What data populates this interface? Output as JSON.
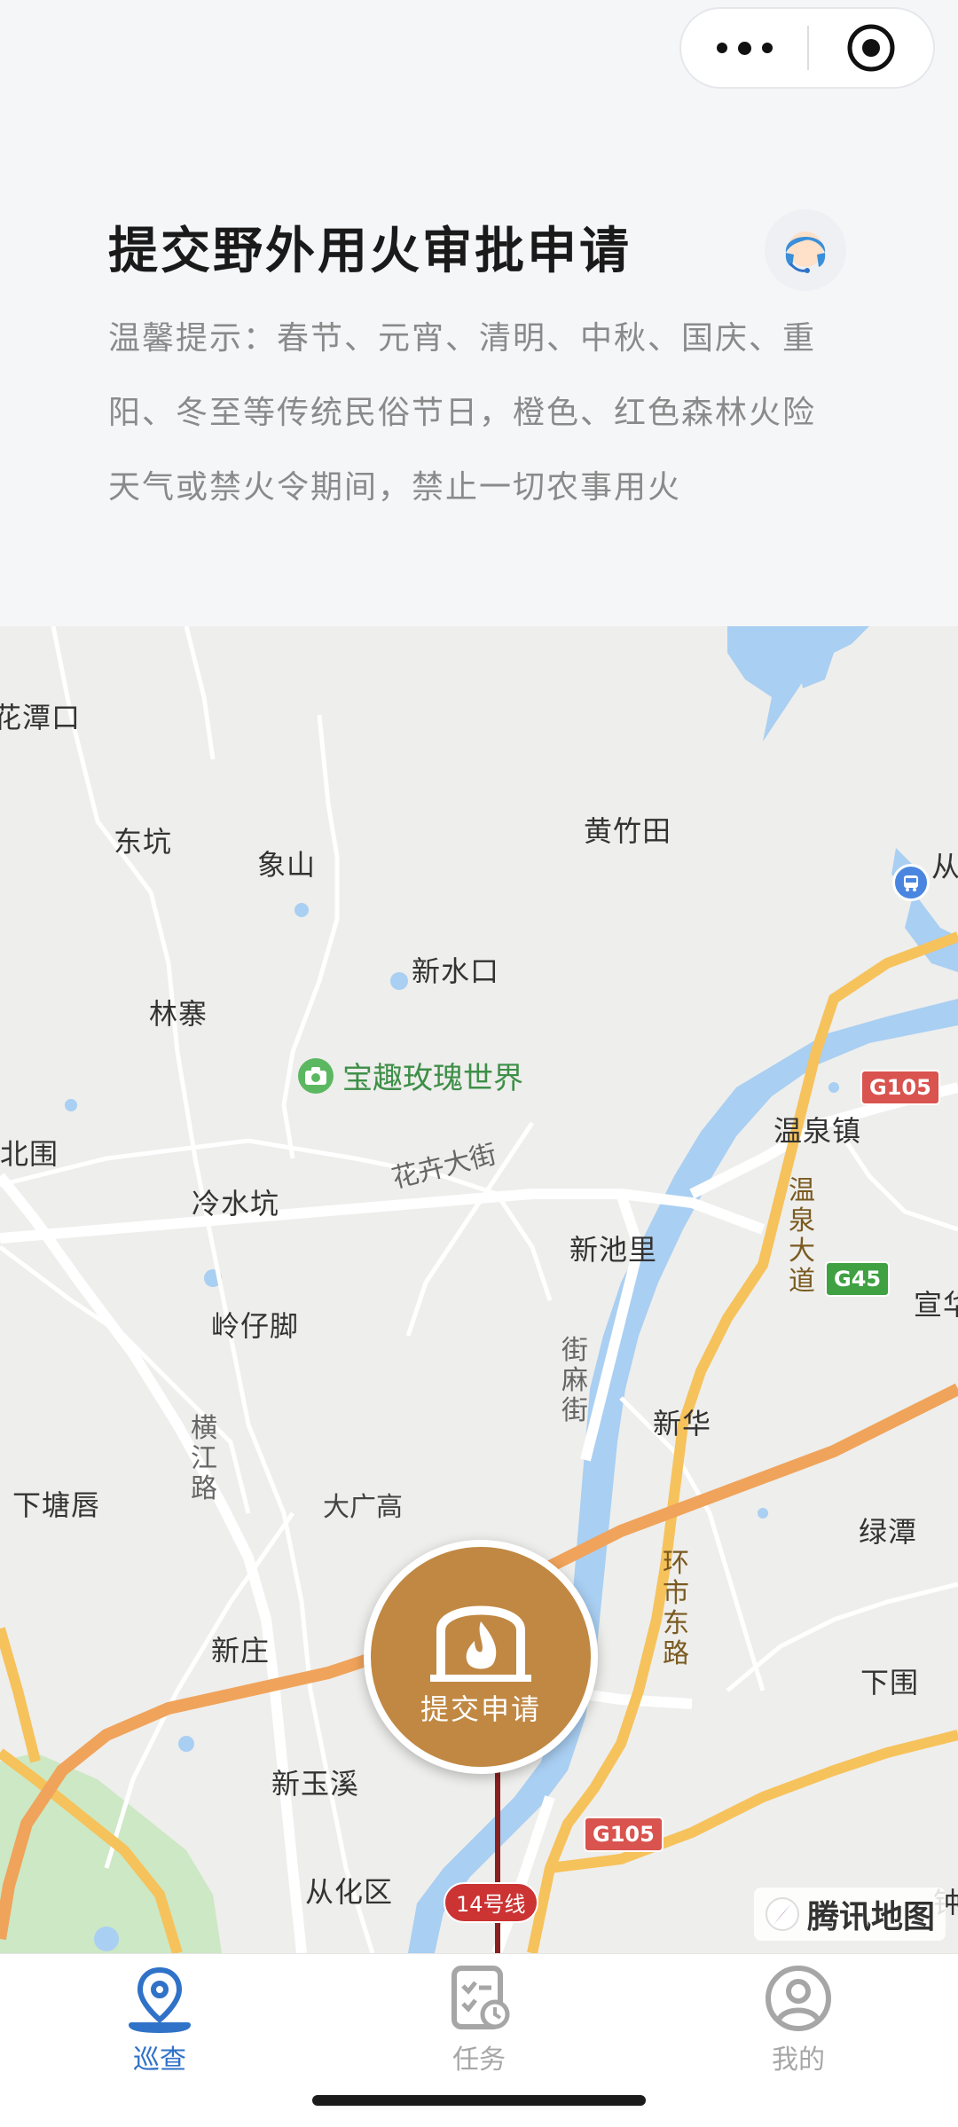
{
  "header": {
    "title": "提交野外用火审批申请",
    "tip": "温馨提示：春节、元宵、清明、中秋、国庆、重阳、冬至等传统民俗节日，橙色、红色森林火险天气或禁火令期间，禁止一切农事用火"
  },
  "map": {
    "places": {
      "p01": "花潭口",
      "p02": "东坑",
      "p03": "象山",
      "p04": "黄竹田",
      "p05": "新水口",
      "p06": "林寨",
      "p07": "北围",
      "p08": "冷水坑",
      "p09": "新池里",
      "p10": "温泉镇",
      "p11": "岭仔脚",
      "p12": "新华",
      "p13": "宣华",
      "p14": "下塘唇",
      "p15": "绿潭",
      "p16": "新庄",
      "p17": "下围",
      "p18": "新玉溪",
      "p19": "从化区",
      "p20": "从",
      "p21": "钟"
    },
    "roads": {
      "r1": "花卉大街",
      "r2": "温泉大道",
      "r3": "街麻街",
      "r4": "横江路",
      "r5": "大广高",
      "r6": "环市东路"
    },
    "shields": {
      "g105a": "G105",
      "g105b": "G105",
      "g45": "G45"
    },
    "poi": "宝趣玫瑰世界",
    "metro": "14号线",
    "submit_label": "提交申请",
    "brand": "腾讯地图"
  },
  "tabs": [
    {
      "label": "巡查",
      "icon": "location-pin-icon",
      "active": true
    },
    {
      "label": "任务",
      "icon": "task-checklist-icon",
      "active": false
    },
    {
      "label": "我的",
      "icon": "user-profile-icon",
      "active": false
    }
  ],
  "colors": {
    "accent_blue": "#2f72c8",
    "submit_brown": "#c08843",
    "water": "#a9cff2",
    "highway": "#f6c25b"
  }
}
